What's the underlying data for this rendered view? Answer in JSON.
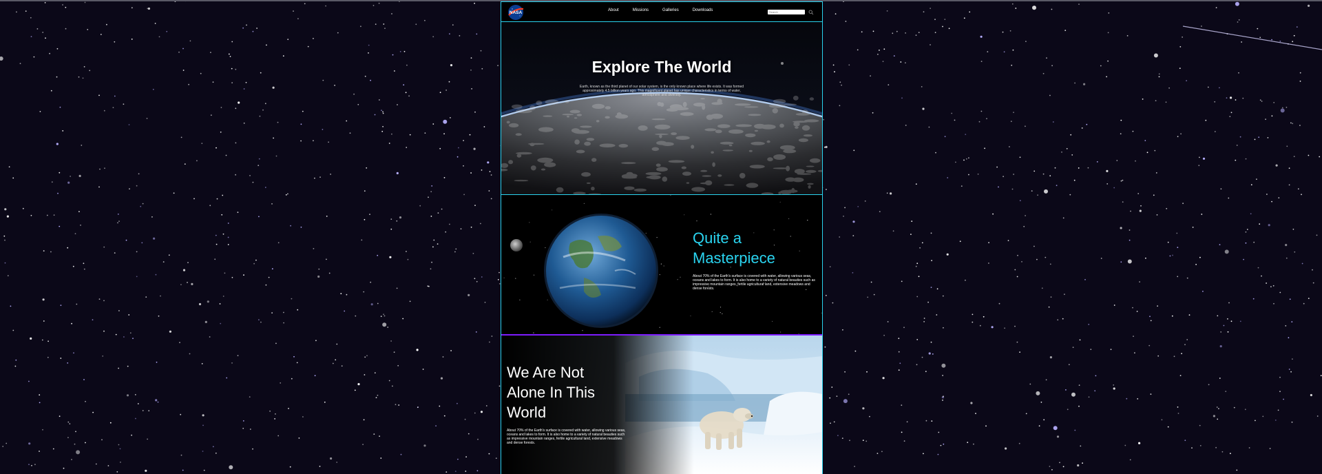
{
  "nav": {
    "logo_text": "NASA",
    "links": [
      "About",
      "Missions",
      "Galleries",
      "Downloads"
    ],
    "search_placeholder": "Search"
  },
  "hero": {
    "title": "Explore The World",
    "text": "Earth, known as the third planet of our solar system, is the only known place where life exists. It was formed approximately 4.5 billion years ago. This magnificent planet has unique characteristics in terms of water, atmosphere and diversity."
  },
  "section2": {
    "title_line1": "Quite a",
    "title_line2": "Masterpiece",
    "text": "About 70% of the Earth's surface is covered with water, allowing various seas, oceans and lakes to form. It is also home to a variety of natural beauties such as impressive mountain ranges, fertile agricultural land, extensive meadows and dense forests."
  },
  "section3": {
    "title_line1": "We Are Not",
    "title_line2": "Alone In This",
    "title_line3": "World",
    "text": "About 70% of the Earth's surface is covered with water, allowing various seas, oceans and lakes to form. It is also home to a variety of natural beauties such as impressive mountain ranges, fertile agricultural land, extensive meadows and dense forests."
  },
  "colors": {
    "accent_cyan": "#2ad4f0",
    "accent_purple": "#7d1cff",
    "sky": "#0b0818"
  }
}
